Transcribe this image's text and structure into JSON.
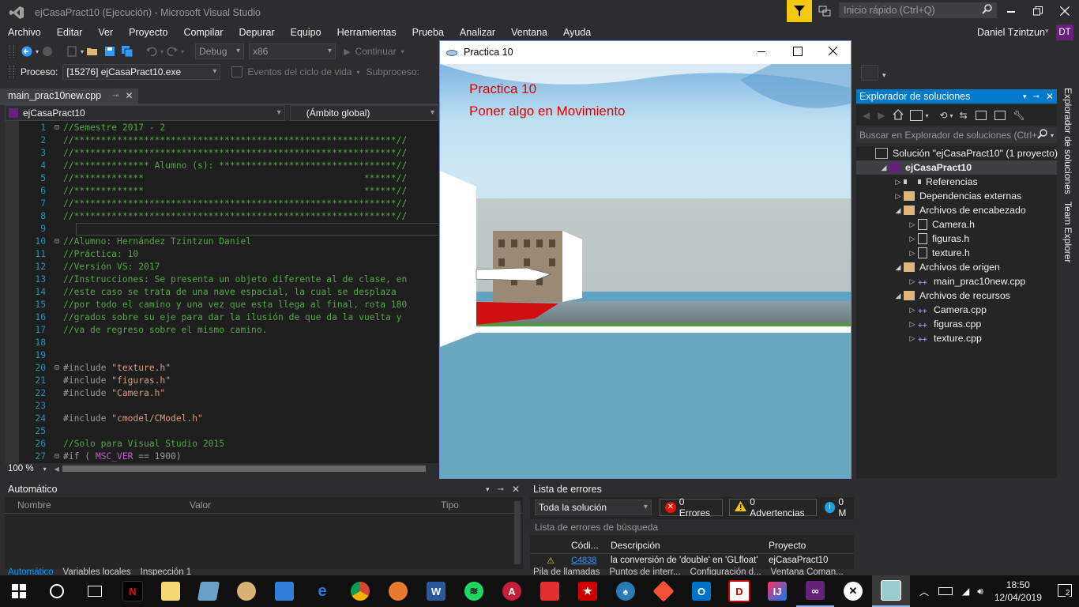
{
  "window": {
    "title": "ejCasaPract10 (Ejecución) - Microsoft Visual Studio",
    "quick_launch_placeholder": "Inicio rápido (Ctrl+Q)",
    "user_name": "Daniel Tzintzun",
    "user_initials": "DT"
  },
  "menu": [
    "Archivo",
    "Editar",
    "Ver",
    "Proyecto",
    "Compilar",
    "Depurar",
    "Equipo",
    "Herramientas",
    "Prueba",
    "Analizar",
    "Ventana",
    "Ayuda"
  ],
  "toolbar": {
    "config": "Debug",
    "platform": "x86",
    "continue_label": "Continuar",
    "process_label": "Proceso:",
    "process_value": "[15276] ejCasaPract10.exe",
    "lifecycle_label": "Eventos del ciclo de vida",
    "subprocess_label": "Subproceso:"
  },
  "editor": {
    "tab": "main_prac10new.cpp",
    "project_combo": "ejCasaPract10",
    "scope_combo": "(Ámbito global)",
    "zoom": "100 %",
    "lines": [
      {
        "n": "1",
        "fold": "⊟",
        "parts": [
          {
            "c": "cm",
            "t": "//Semestre 2017 - 2"
          }
        ]
      },
      {
        "n": "2",
        "fold": "",
        "parts": [
          {
            "c": "cm",
            "t": "//************************************************************//"
          }
        ]
      },
      {
        "n": "3",
        "fold": "",
        "parts": [
          {
            "c": "cm",
            "t": "//************************************************************//"
          }
        ]
      },
      {
        "n": "4",
        "fold": "",
        "parts": [
          {
            "c": "cm",
            "t": "//************** Alumno (s): *********************************//"
          }
        ]
      },
      {
        "n": "5",
        "fold": "",
        "parts": [
          {
            "c": "cm",
            "t": "//*************                                         ******//"
          }
        ]
      },
      {
        "n": "6",
        "fold": "",
        "parts": [
          {
            "c": "cm",
            "t": "//*************                                         ******//"
          }
        ]
      },
      {
        "n": "7",
        "fold": "",
        "parts": [
          {
            "c": "cm",
            "t": "//************************************************************//"
          }
        ]
      },
      {
        "n": "8",
        "fold": "",
        "parts": [
          {
            "c": "cm",
            "t": "//************************************************************//"
          }
        ]
      },
      {
        "n": "9",
        "fold": "",
        "parts": [
          {
            "c": "tx",
            "t": ""
          }
        ]
      },
      {
        "n": "10",
        "fold": "⊟",
        "parts": [
          {
            "c": "cm",
            "t": "//Alumno: Hernández Tzintzun Daniel"
          }
        ]
      },
      {
        "n": "11",
        "fold": "",
        "parts": [
          {
            "c": "cm",
            "t": "//Práctica: 10"
          }
        ]
      },
      {
        "n": "12",
        "fold": "",
        "parts": [
          {
            "c": "cm",
            "t": "//Versión VS: 2017"
          }
        ]
      },
      {
        "n": "13",
        "fold": "",
        "parts": [
          {
            "c": "cm",
            "t": "//Instrucciones: Se presenta un objeto diferente al de clase, en"
          }
        ]
      },
      {
        "n": "14",
        "fold": "",
        "parts": [
          {
            "c": "cm",
            "t": "//este caso se trata de una nave espacial, la cual se desplaza"
          }
        ]
      },
      {
        "n": "15",
        "fold": "",
        "parts": [
          {
            "c": "cm",
            "t": "//por todo el camino y una vez que esta llega al final, rota 180"
          }
        ]
      },
      {
        "n": "16",
        "fold": "",
        "parts": [
          {
            "c": "cm",
            "t": "//grados sobre su eje para dar la ilusión de que da la vuelta y"
          }
        ]
      },
      {
        "n": "17",
        "fold": "",
        "parts": [
          {
            "c": "cm",
            "t": "//va de regreso sobre el mismo camino."
          }
        ]
      },
      {
        "n": "18",
        "fold": "",
        "parts": [
          {
            "c": "tx",
            "t": ""
          }
        ]
      },
      {
        "n": "19",
        "fold": "",
        "parts": [
          {
            "c": "tx",
            "t": ""
          }
        ]
      },
      {
        "n": "20",
        "fold": "⊟",
        "parts": [
          {
            "c": "pp",
            "t": "#include "
          },
          {
            "c": "str",
            "t": "\"texture.h\""
          }
        ]
      },
      {
        "n": "21",
        "fold": "",
        "parts": [
          {
            "c": "pp",
            "t": "#include "
          },
          {
            "c": "str",
            "t": "\"figuras.h\""
          }
        ]
      },
      {
        "n": "22",
        "fold": "",
        "parts": [
          {
            "c": "pp",
            "t": "#include "
          },
          {
            "c": "str",
            "t": "\"Camera.h\""
          }
        ]
      },
      {
        "n": "23",
        "fold": "",
        "parts": [
          {
            "c": "tx",
            "t": ""
          }
        ]
      },
      {
        "n": "24",
        "fold": "",
        "parts": [
          {
            "c": "pp",
            "t": "#include "
          },
          {
            "c": "str",
            "t": "\"cmodel/CModel.h\""
          }
        ]
      },
      {
        "n": "25",
        "fold": "",
        "parts": [
          {
            "c": "tx",
            "t": ""
          }
        ]
      },
      {
        "n": "26",
        "fold": "",
        "parts": [
          {
            "c": "cm",
            "t": "//Solo para Visual Studio 2015"
          }
        ]
      },
      {
        "n": "27",
        "fold": "⊟",
        "parts": [
          {
            "c": "pp",
            "t": "#if ( "
          },
          {
            "c": "mac",
            "t": "MSC_VER"
          },
          {
            "c": "pp",
            "t": " == 1900)"
          }
        ]
      }
    ]
  },
  "app": {
    "title": "Practica 10",
    "line1": "Practica 10",
    "line2": "Poner algo en Movimiento"
  },
  "solution": {
    "header": "Explorador de soluciones",
    "search_placeholder": "Buscar en Explorador de soluciones (Ctrl+",
    "items": [
      {
        "label": "Solución \"ejCasaPract10\"  (1 proyecto)",
        "indent": 0,
        "tri": "",
        "icon": "sln"
      },
      {
        "label": "ejCasaPract10",
        "indent": 1,
        "tri": "◢",
        "icon": "proj",
        "bold": true,
        "sel": true
      },
      {
        "label": "Referencias",
        "indent": 2,
        "tri": "▷",
        "icon": "ref"
      },
      {
        "label": "Dependencias externas",
        "indent": 2,
        "tri": "▷",
        "icon": "folder"
      },
      {
        "label": "Archivos de encabezado",
        "indent": 2,
        "tri": "◢",
        "icon": "folder"
      },
      {
        "label": "Camera.h",
        "indent": 3,
        "tri": "▷",
        "icon": "h"
      },
      {
        "label": "figuras.h",
        "indent": 3,
        "tri": "▷",
        "icon": "h"
      },
      {
        "label": "texture.h",
        "indent": 3,
        "tri": "▷",
        "icon": "h"
      },
      {
        "label": "Archivos de origen",
        "indent": 2,
        "tri": "◢",
        "icon": "folder"
      },
      {
        "label": "main_prac10new.cpp",
        "indent": 3,
        "tri": "▷",
        "icon": "cpp"
      },
      {
        "label": "Archivos de recursos",
        "indent": 2,
        "tri": "◢",
        "icon": "folder"
      },
      {
        "label": "Camera.cpp",
        "indent": 3,
        "tri": "▷",
        "icon": "cpp"
      },
      {
        "label": "figuras.cpp",
        "indent": 3,
        "tri": "▷",
        "icon": "cpp"
      },
      {
        "label": "texture.cpp",
        "indent": 3,
        "tri": "▷",
        "icon": "cpp"
      }
    ],
    "side_tab_1": "Explorador de soluciones",
    "side_tab_2": "Team Explorer"
  },
  "auto_panel": {
    "title": "Automático",
    "col_name": "Nombre",
    "col_value": "Valor",
    "col_type": "Tipo",
    "tabs": [
      "Automático",
      "Variables locales",
      "Inspección 1"
    ]
  },
  "errors": {
    "title": "Lista de errores",
    "scope": "Toda la solución",
    "errors_btn": "0 Errores",
    "warnings_btn": "0 Advertencias",
    "messages_btn": "0 M",
    "search_label": "Lista de errores de búsqueda",
    "col_code": "Códi...",
    "col_desc": "Descripción",
    "col_proj": "Proyecto",
    "row_code": "C4838",
    "row_desc": "la conversión de 'double' en 'GLfloat'",
    "row_proj": "ejCasaPract10",
    "bottom_tabs": [
      "Pila de llamadas",
      "Puntos de interr...",
      "Configuración d...",
      "Ventana Coman..."
    ]
  },
  "taskbar": {
    "time": "18:50",
    "date": "12/04/2019",
    "notif_count": "2"
  },
  "colors": {
    "vs_bg": "#2d2d30",
    "accent": "#007acc",
    "editor_bg": "#1e1e1e",
    "comment": "#57a64a",
    "app_text": "#e00000"
  }
}
